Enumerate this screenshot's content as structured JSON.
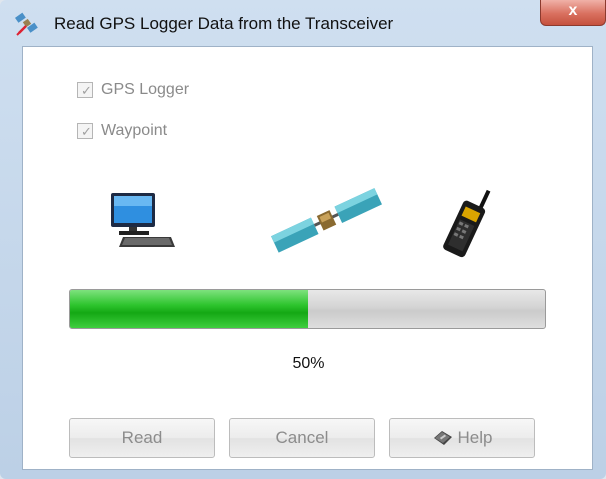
{
  "window": {
    "title": "Read GPS Logger Data from the Transceiver",
    "close_label": "x",
    "app_icon": "satellite-app-icon"
  },
  "options": [
    {
      "label": "GPS Logger",
      "checked": true,
      "enabled": false
    },
    {
      "label": "Waypoint",
      "checked": true,
      "enabled": false
    }
  ],
  "illustration": {
    "icons": [
      "computer-icon",
      "satellite-icon",
      "transceiver-icon"
    ]
  },
  "progress": {
    "value": 0.5,
    "text": "50%",
    "color": "#2dc42d"
  },
  "buttons": {
    "read": "Read",
    "cancel": "Cancel",
    "help": "Help",
    "help_icon": "help-book-icon"
  }
}
